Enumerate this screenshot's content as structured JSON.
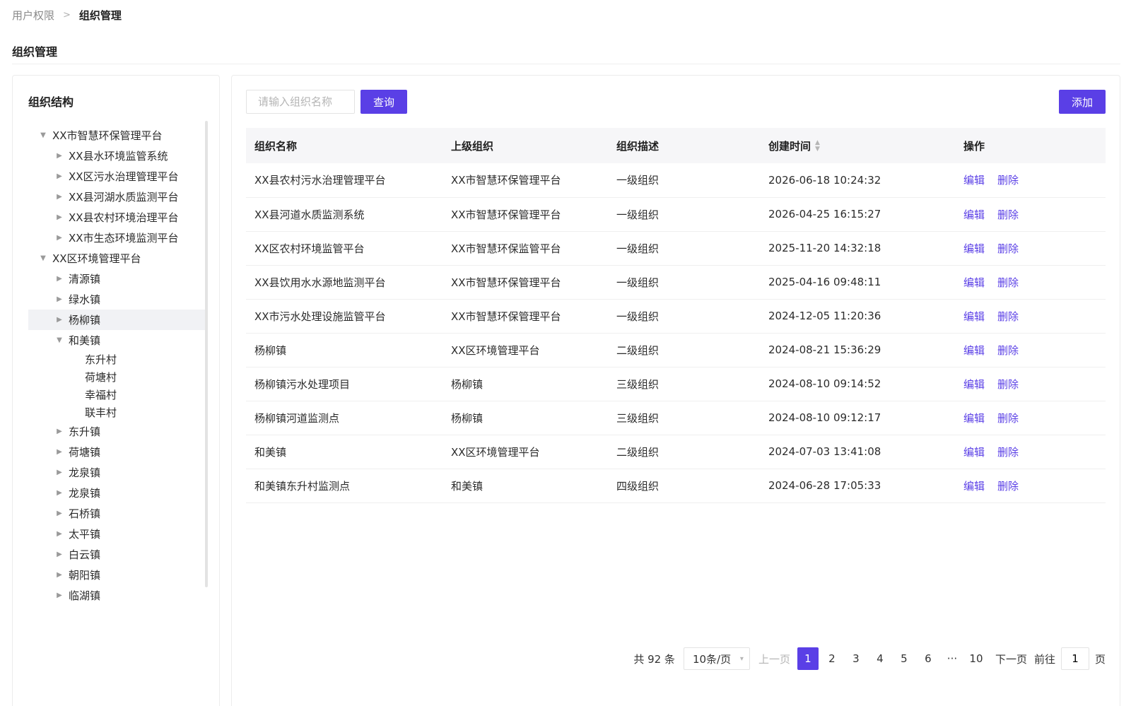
{
  "breadcrumb": {
    "parent": "用户权限",
    "separator": ">",
    "current": "组织管理"
  },
  "page_title": "组织管理",
  "tree": {
    "title": "组织结构",
    "nodes": [
      {
        "label": "XX市智慧环保管理平台",
        "level": 0,
        "state": "expanded"
      },
      {
        "label": "XX县水环境监管系统",
        "level": 1,
        "state": "collapsed"
      },
      {
        "label": "XX区污水治理管理平台",
        "level": 1,
        "state": "collapsed"
      },
      {
        "label": "XX县河湖水质监测平台",
        "level": 1,
        "state": "collapsed"
      },
      {
        "label": "XX县农村环境治理平台",
        "level": 1,
        "state": "collapsed"
      },
      {
        "label": "XX市生态环境监测平台",
        "level": 1,
        "state": "collapsed"
      },
      {
        "label": "XX区环境管理平台",
        "level": 0,
        "state": "expanded"
      },
      {
        "label": "清源镇",
        "level": 1,
        "state": "collapsed"
      },
      {
        "label": "绿水镇",
        "level": 1,
        "state": "collapsed"
      },
      {
        "label": "杨柳镇",
        "level": 1,
        "state": "collapsed",
        "selected": true
      },
      {
        "label": "和美镇",
        "level": 1,
        "state": "expanded"
      },
      {
        "label": "东升村",
        "level": 2,
        "state": "leaf"
      },
      {
        "label": "荷塘村",
        "level": 2,
        "state": "leaf"
      },
      {
        "label": "幸福村",
        "level": 2,
        "state": "leaf"
      },
      {
        "label": "联丰村",
        "level": 2,
        "state": "leaf"
      },
      {
        "label": "东升镇",
        "level": 1,
        "state": "collapsed"
      },
      {
        "label": "荷塘镇",
        "level": 1,
        "state": "collapsed"
      },
      {
        "label": "龙泉镇",
        "level": 1,
        "state": "collapsed"
      },
      {
        "label": "龙泉镇",
        "level": 1,
        "state": "collapsed"
      },
      {
        "label": "石桥镇",
        "level": 1,
        "state": "collapsed"
      },
      {
        "label": "太平镇",
        "level": 1,
        "state": "collapsed"
      },
      {
        "label": "白云镇",
        "level": 1,
        "state": "collapsed"
      },
      {
        "label": "朝阳镇",
        "level": 1,
        "state": "collapsed"
      },
      {
        "label": "临湖镇",
        "level": 1,
        "state": "collapsed"
      }
    ]
  },
  "search": {
    "placeholder": "请输入组织名称",
    "value": "",
    "button": "查询"
  },
  "add_button": "添加",
  "table": {
    "columns": [
      "组织名称",
      "上级组织",
      "组织描述",
      "创建时间",
      "操作"
    ],
    "sortable_column": "创建时间",
    "actions": {
      "edit": "编辑",
      "delete": "删除"
    },
    "rows": [
      {
        "name": "XX县农村污水治理管理平台",
        "parent": "XX市智慧环保管理平台",
        "desc": "一级组织",
        "created": "2026-06-18 10:24:32"
      },
      {
        "name": "XX县河道水质监测系统",
        "parent": "XX市智慧环保管理平台",
        "desc": "一级组织",
        "created": "2026-04-25 16:15:27"
      },
      {
        "name": "XX区农村环境监管平台",
        "parent": "XX市智慧环保监管平台",
        "desc": "一级组织",
        "created": "2025-11-20 14:32:18"
      },
      {
        "name": "XX县饮用水水源地监测平台",
        "parent": "XX市智慧环保管理平台",
        "desc": "一级组织",
        "created": "2025-04-16 09:48:11"
      },
      {
        "name": "XX市污水处理设施监管平台",
        "parent": "XX市智慧环保管理平台",
        "desc": "一级组织",
        "created": "2024-12-05 11:20:36"
      },
      {
        "name": "杨柳镇",
        "parent": "XX区环境管理平台",
        "desc": "二级组织",
        "created": "2024-08-21 15:36:29"
      },
      {
        "name": "杨柳镇污水处理项目",
        "parent": "杨柳镇",
        "desc": "三级组织",
        "created": "2024-08-10 09:14:52"
      },
      {
        "name": "杨柳镇河道监测点",
        "parent": "杨柳镇",
        "desc": "三级组织",
        "created": "2024-08-10 09:12:17"
      },
      {
        "name": "和美镇",
        "parent": "XX区环境管理平台",
        "desc": "二级组织",
        "created": "2024-07-03 13:41:08"
      },
      {
        "name": "和美镇东升村监测点",
        "parent": "和美镇",
        "desc": "四级组织",
        "created": "2024-06-28 17:05:33"
      }
    ]
  },
  "pagination": {
    "total_text": "共 92 条",
    "page_size": "10条/页",
    "prev": "上一页",
    "pages": [
      "1",
      "2",
      "3",
      "4",
      "5",
      "6",
      "···",
      "10"
    ],
    "current_page": "1",
    "next": "下一页",
    "goto_label": "前往",
    "goto_value": "1",
    "goto_suffix": "页"
  },
  "colors": {
    "primary": "#5a3fe6",
    "link": "#5a3fe6",
    "selected_row_bg": "#f1f2f5"
  }
}
